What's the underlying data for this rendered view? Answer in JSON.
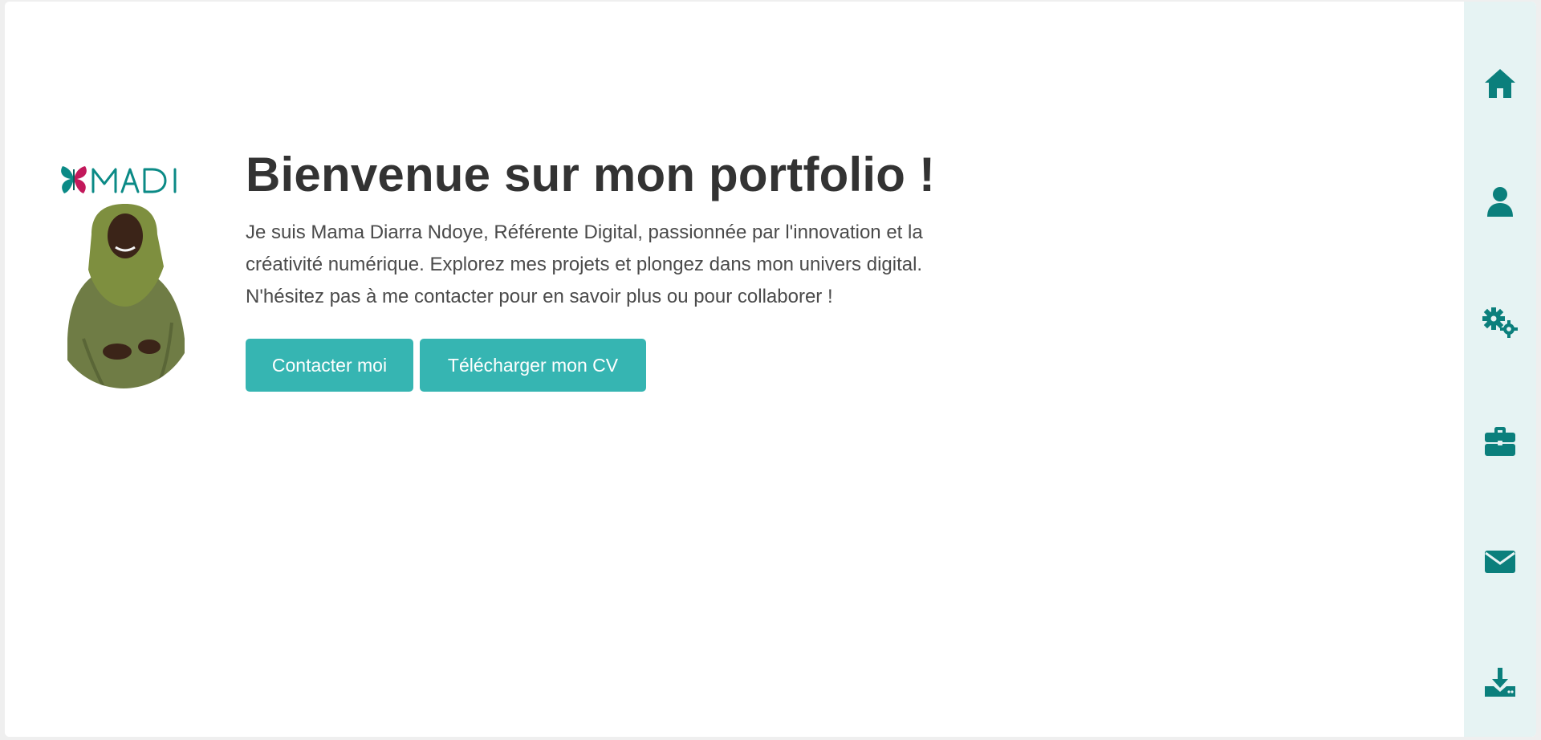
{
  "hero": {
    "logo_text": "MADI",
    "title": "Bienvenue sur mon portfolio !",
    "description": "Je suis Mama Diarra Ndoye, Référente Digital, passionnée par l'innovation et la créativité numérique. Explorez mes projets et plongez dans mon univers digital. N'hésitez pas à me contacter pour en savoir plus ou pour collaborer !",
    "buttons": {
      "contact_label": "Contacter moi",
      "cv_label": "Télécharger mon CV"
    }
  },
  "sidenav": {
    "items": [
      {
        "icon": "home-icon"
      },
      {
        "icon": "user-icon"
      },
      {
        "icon": "gears-icon"
      },
      {
        "icon": "briefcase-icon"
      },
      {
        "icon": "envelope-icon"
      },
      {
        "icon": "download-icon"
      }
    ]
  },
  "colors": {
    "accent": "#36b5b2",
    "nav_icon": "#0b7f7c",
    "nav_bg": "#e6f3f3",
    "title": "#333333",
    "text": "#4a4a4a"
  }
}
